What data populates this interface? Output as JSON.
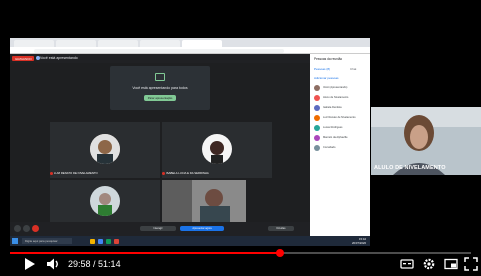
{
  "video": {
    "current_time": "29:58",
    "duration": "51:14",
    "time_separator": " / ",
    "progress": 0.585
  },
  "meet": {
    "recording_label": "GRAVANDO",
    "presenter_label": "Você está apresentando",
    "presenting_box_text": "Você está apresentando para todos",
    "presenting_box_button": "Parar apresentação",
    "tiles": [
      {
        "name": "LUIZ RENATO DE NIVELAMENTO"
      },
      {
        "name": "ISABELA LUCIA E DA SERRINHA"
      },
      {
        "name": ""
      },
      {
        "name": ""
      }
    ],
    "bottom_pills": [
      {
        "label": "Interagir"
      },
      {
        "label": "Apresentar agora"
      },
      {
        "label": "Dúvidas"
      }
    ]
  },
  "side_panel": {
    "title": "Pessoas da reunião",
    "tab_people": "Pessoas (8)",
    "tab_chat": "Chat",
    "add_label": "Adicionar pessoas",
    "participants": [
      {
        "name": "Você (Apresentando)",
        "color": "#8d6e63"
      },
      {
        "name": "Aluno de Nivelamento",
        "color": "#ef5350"
      },
      {
        "name": "Isabela Dentista",
        "color": "#5c6bc0"
      },
      {
        "name": "Luiz Renato de Nivelamento",
        "color": "#ef6c00"
      },
      {
        "name": "Lucas Rodrigues",
        "color": "#26a69a"
      },
      {
        "name": "Marcelo da Alphaville",
        "color": "#ab47bc"
      },
      {
        "name": "Convidado",
        "color": "#78909c"
      }
    ]
  },
  "taskbar": {
    "search_placeholder": "Digite aqui para pesquisar",
    "time": "15:42",
    "date": "20/07/2020"
  },
  "webcam": {
    "label": "ALULO DE NIVELAMENTO"
  },
  "colors": {
    "progress_red": "#ff0000",
    "meet_dark": "#202124",
    "accent_green": "#81c995"
  },
  "icons": [
    "play-icon",
    "volume-icon",
    "captions-icon",
    "settings-icon",
    "miniplayer-icon",
    "fullscreen-icon"
  ]
}
